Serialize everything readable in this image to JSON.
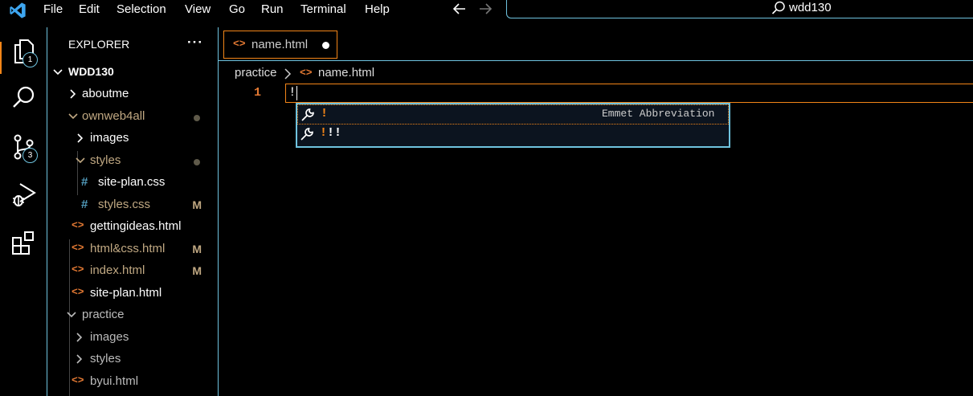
{
  "menu": [
    "File",
    "Edit",
    "Selection",
    "View",
    "Go",
    "Run",
    "Terminal",
    "Help"
  ],
  "search": {
    "text": "wdd130"
  },
  "activity_badges": {
    "explorer": "1",
    "source_control": "3"
  },
  "explorer": {
    "title": "EXPLORER",
    "more": "···",
    "root": "WDD130",
    "items": [
      {
        "label": "aboutme"
      },
      {
        "label": "ownweb4all"
      },
      {
        "label": "images"
      },
      {
        "label": "styles"
      },
      {
        "label": "site-plan.css"
      },
      {
        "label": "styles.css",
        "status": "M"
      },
      {
        "label": "gettingideas.html"
      },
      {
        "label": "html&css.html",
        "status": "M"
      },
      {
        "label": "index.html",
        "status": "M"
      },
      {
        "label": "site-plan.html"
      },
      {
        "label": "practice"
      },
      {
        "label": "images"
      },
      {
        "label": "styles"
      },
      {
        "label": "byui.html"
      }
    ]
  },
  "tab": {
    "label": "name.html"
  },
  "breadcrumb": {
    "folder": "practice",
    "file": "name.html"
  },
  "editor": {
    "line_number": "1",
    "line_text": "!"
  },
  "suggest": {
    "items": [
      {
        "char": "!",
        "rest": "",
        "detail": "Emmet Abbreviation"
      },
      {
        "char": "!",
        "rest": "!!",
        "detail": ""
      }
    ]
  },
  "colors": {
    "accent": "#6fc3df",
    "focus": "#f38518",
    "modified": "#c0a882",
    "html_icon": "#e37933",
    "css_icon": "#519aba"
  }
}
